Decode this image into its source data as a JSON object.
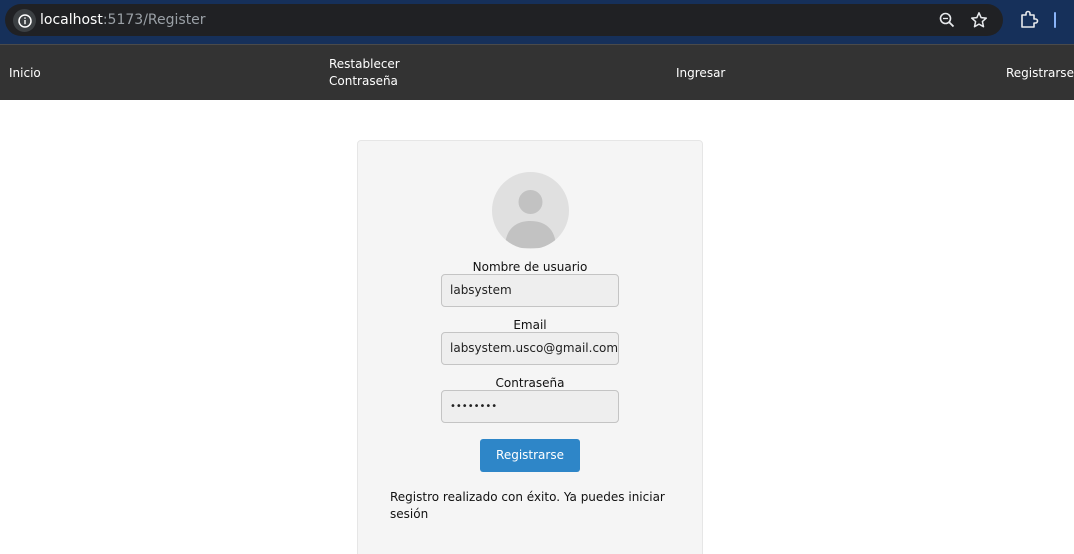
{
  "browser": {
    "url_host": "localhost",
    "url_path": ":5173/Register",
    "icons": [
      "info-icon",
      "zoom-icon",
      "bookmark-star-icon",
      "extensions-icon"
    ]
  },
  "navbar": {
    "inicio": "Inicio",
    "reset_line1": "Restablecer",
    "reset_line2": "Contraseña",
    "ingresar": "Ingresar",
    "registrarse": "Registrarse"
  },
  "form": {
    "avatar_icon": "user-avatar-icon",
    "username_label": "Nombre de usuario",
    "username_value": "labsystem",
    "email_label": "Email",
    "email_value": "labsystem.usco@gmail.com",
    "password_label": "Contraseña",
    "password_value": "••••••••",
    "submit_label": "Registrarse",
    "status_message": "Registro realizado con éxito. Ya puedes iniciar sesión"
  },
  "colors": {
    "navbar_bg": "#333333",
    "button_bg": "#2e86c8",
    "card_bg": "#f5f5f5"
  }
}
